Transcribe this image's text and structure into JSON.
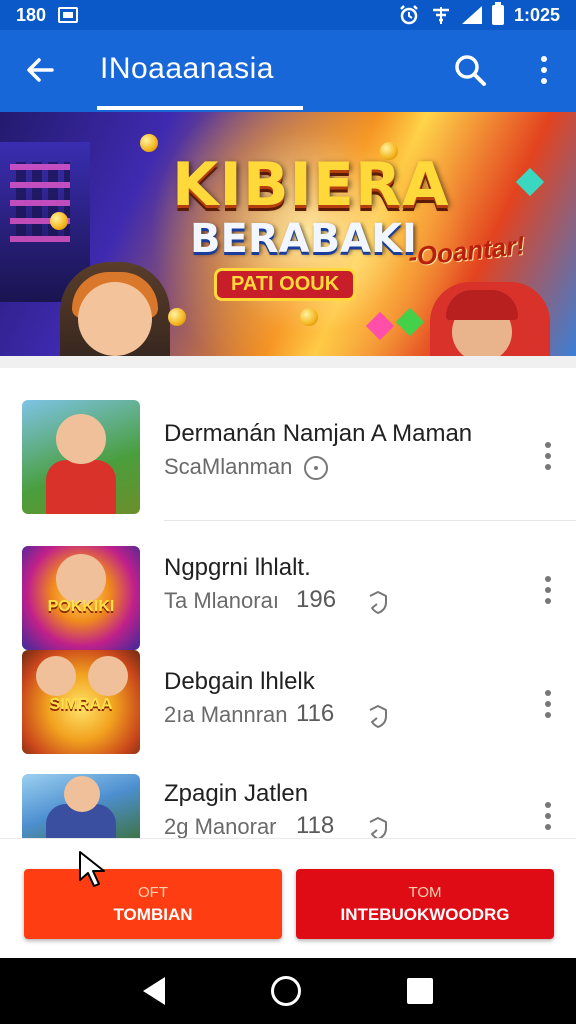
{
  "status_bar": {
    "time_left": "180",
    "clock": "1:025"
  },
  "app_bar": {
    "title": "INoaaanasia",
    "icons": [
      "back-arrow-icon",
      "search-icon",
      "more-vert-icon"
    ]
  },
  "banner": {
    "logo_line1": "KIBIERA",
    "logo_line2": "BERABAKI",
    "logo_line3": "PATI OOUK",
    "promo": "-Ooantar!"
  },
  "list": {
    "items": [
      {
        "name": "Dermanán Namjan A Maman",
        "subtitle": "ScaMlanman",
        "count": "",
        "icon": "clock-icon",
        "thumb_label": ""
      },
      {
        "name": "Ngpgrni lhlalt.",
        "subtitle": "Ta Mlanoraı",
        "count": "196",
        "icon": "shield-icon",
        "thumb_label": "POKKIKI"
      },
      {
        "name": "Debgain lhlelk",
        "subtitle": "2ıa Mannran",
        "count": "116",
        "icon": "shield-icon",
        "thumb_label": "SIMRAA"
      },
      {
        "name": "Zpagin Jatlen",
        "subtitle": "2g Manorar",
        "count": "118",
        "icon": "shield-icon",
        "thumb_label": ""
      }
    ]
  },
  "footer": {
    "left_small": "OFT",
    "left_label": "TOMBIAN",
    "right_small": "TOM",
    "right_label": "INTEBUOKWOODRG",
    "left_color": "#fe3e12",
    "right_color": "#df0c15"
  },
  "nav_bar": {
    "icons": [
      "nav-back-icon",
      "nav-home-icon",
      "nav-recents-icon"
    ]
  },
  "colors": {
    "primary": "#1767d9",
    "status": "#0b59c9"
  }
}
